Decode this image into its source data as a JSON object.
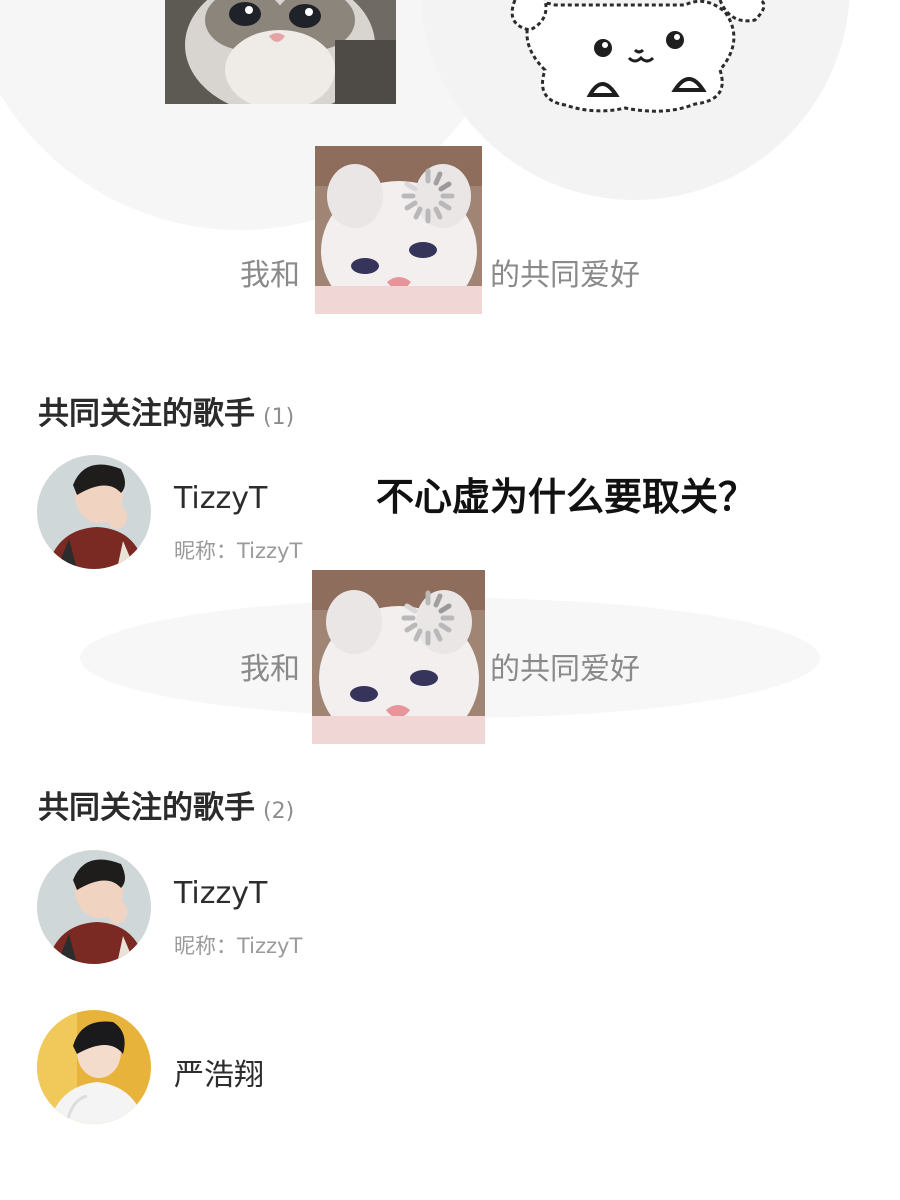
{
  "hobby_lines": [
    {
      "prefix": "我和",
      "suffix": "的共同爱好"
    },
    {
      "prefix": "我和",
      "suffix": "的共同爱好"
    }
  ],
  "sections": [
    {
      "title": "共同关注的歌手",
      "count": "(1)",
      "artists": [
        {
          "name": "TizzyT",
          "nickname": "昵称：TizzyT"
        }
      ]
    },
    {
      "title": "共同关注的歌手",
      "count": "(2)",
      "artists": [
        {
          "name": "TizzyT",
          "nickname": "昵称：TizzyT"
        },
        {
          "name": "严浩翔"
        }
      ]
    }
  ],
  "caption": "不心虚为什么要取关？",
  "colors": {
    "title": "#2b2b2b",
    "secondary_text": "#8a8a8a",
    "background_arcs": "#f6f6f6"
  },
  "icons": [
    "loading-spinner-icon"
  ]
}
